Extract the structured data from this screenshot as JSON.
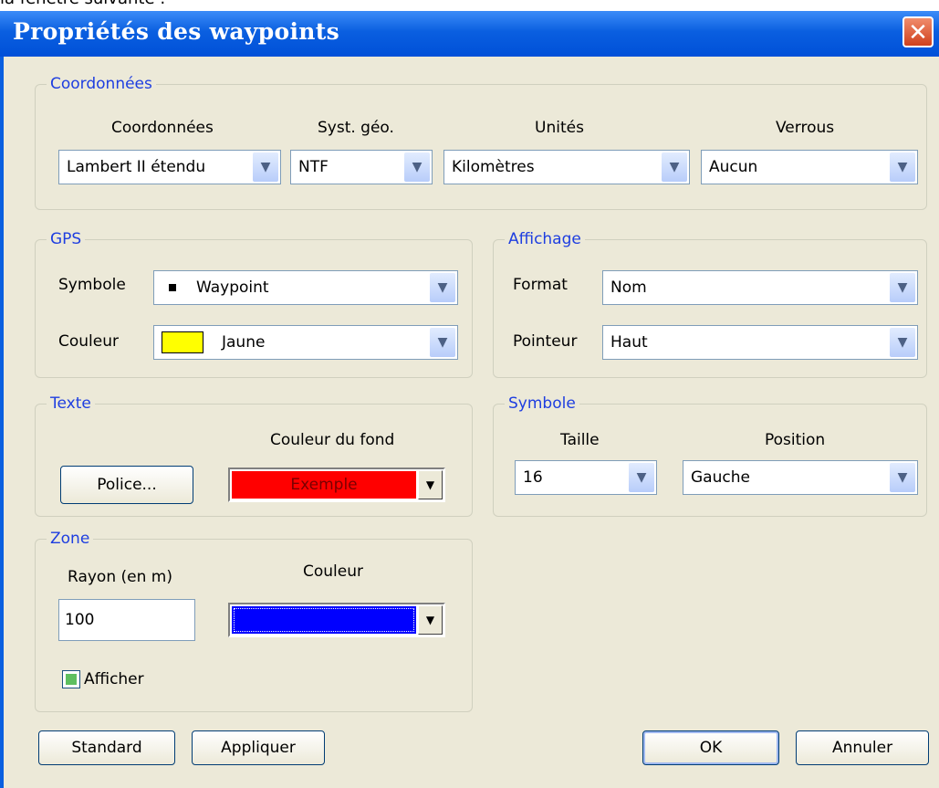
{
  "page": {
    "above_text": "la fenêtre suivante :"
  },
  "window": {
    "title": "Propriétés des waypoints",
    "close_glyph": "✕"
  },
  "coordonnees": {
    "legend": "Coordonnées",
    "headers": [
      "Coordonnées",
      "Syst. géo.",
      "Unités",
      "Verrous"
    ],
    "values": [
      "Lambert II étendu",
      "NTF",
      "Kilomètres",
      "Aucun"
    ]
  },
  "gps": {
    "legend": "GPS",
    "symbole_label": "Symbole",
    "symbole_value": "Waypoint",
    "couleur_label": "Couleur",
    "couleur_value": "Jaune",
    "couleur_hex": "#ffff00"
  },
  "affichage": {
    "legend": "Affichage",
    "format_label": "Format",
    "format_value": "Nom",
    "pointeur_label": "Pointeur",
    "pointeur_value": "Haut"
  },
  "texte": {
    "legend": "Texte",
    "police_button": "Police...",
    "couleur_fond_label": "Couleur du fond",
    "couleur_fond_value": "Exemple",
    "couleur_fond_hex": "#ff0000"
  },
  "symbole": {
    "legend": "Symbole",
    "taille_label": "Taille",
    "taille_value": "16",
    "position_label": "Position",
    "position_value": "Gauche"
  },
  "zone": {
    "legend": "Zone",
    "rayon_label": "Rayon (en m)",
    "rayon_value": "100",
    "couleur_label": "Couleur",
    "couleur_hex": "#0000ff",
    "afficher_label": "Afficher",
    "afficher_checked": true
  },
  "buttons": {
    "standard": "Standard",
    "appliquer": "Appliquer",
    "ok": "OK",
    "annuler": "Annuler"
  },
  "icons": {
    "dropdown": "chevron-down-icon",
    "close": "close-icon"
  }
}
